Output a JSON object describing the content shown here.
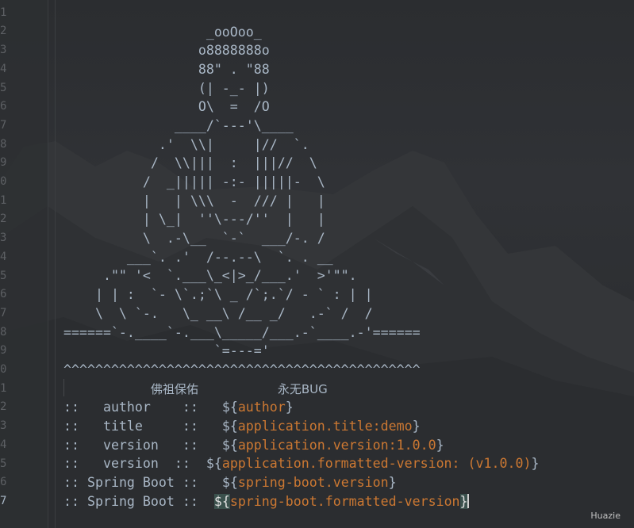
{
  "editor": {
    "line_numbers": [
      "1",
      "2",
      "3",
      "4",
      "5",
      "6",
      "7",
      "8",
      "9",
      "0",
      "1",
      "2",
      "3",
      "4",
      "5",
      "6",
      "7",
      "8",
      "9",
      "0",
      "1",
      "2",
      "3",
      "4",
      "5",
      "6",
      "7"
    ],
    "ascii_art": [
      "",
      "                  _ooOoo_",
      "                 o8888888o",
      "                 88\" . \"88",
      "                 (| -_- |)",
      "                 O\\  =  /O",
      "              ____/`---'\\____",
      "            .'  \\\\|     |//  `.",
      "           /  \\\\|||  :  |||//  \\",
      "          /  _||||| -:- |||||-  \\",
      "          |   | \\\\\\  -  /// |   |",
      "          | \\_|  ''\\---/''  |   |",
      "          \\  .-\\__  `-`  ___/-. /",
      "        ___`. .'  /--.--\\  `. . __",
      "     .\"\" '<  `.___\\_<|>_/___.'  >'\"\".",
      "    | | :  `- \\`.;`\\ _ /`;.`/ - ` : | |",
      "    \\  \\ `-.   \\_ __\\ /__ _/   .-` /  /",
      "======`-.____`-.___\\_____/___.-`____.-'======",
      "                   `=---='",
      "^^^^^^^^^^^^^^^^^^^^^^^^^^^^^^^^^^^^^^^^^^^^^"
    ],
    "blessing_line": {
      "left": "佛祖保佑",
      "right": "永无BUG"
    },
    "props": [
      {
        "prefix": "::   ",
        "key": "author",
        "sep": "    ::   ",
        "open": "${",
        "var": "author",
        "close": "}"
      },
      {
        "prefix": "::   ",
        "key": "title",
        "sep": "     ::   ",
        "open": "${",
        "var": "application.title:demo",
        "close": "}"
      },
      {
        "prefix": "::   ",
        "key": "version",
        "sep": "   ::   ",
        "open": "${",
        "var": "application.version:1.0.0",
        "close": "}"
      },
      {
        "prefix": "::   ",
        "key": "version",
        "sep": "  ::  ",
        "open": "${",
        "var": "application.formatted-version: (v1.0.0)",
        "close": "}"
      },
      {
        "prefix": ":: ",
        "key": "Spring Boot",
        "sep": " ::   ",
        "open": "${",
        "var": "spring-boot.version",
        "close": "}"
      },
      {
        "prefix": ":: ",
        "key": "Spring Boot",
        "sep": " ::  ",
        "open": "${",
        "var": "spring-boot.formatted-version",
        "close": "}"
      }
    ],
    "current_line_index": 26
  },
  "watermark": "Huazie",
  "colors": {
    "text": "#a9b7c6",
    "variable": "#cc7832",
    "line_number": "#5d6064",
    "background": "#2a2c2e"
  }
}
